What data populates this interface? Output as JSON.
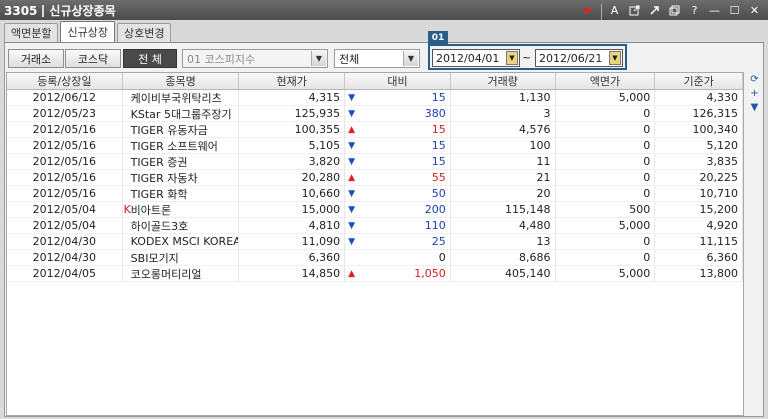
{
  "window": {
    "code": "3305",
    "title": "신규상장종목"
  },
  "titlebar_icons": [
    "play-icon",
    "font-icon",
    "export-icon",
    "link-icon",
    "window-icon",
    "help-icon",
    "minimize-icon",
    "maximize-icon",
    "close-icon"
  ],
  "titlebar_labels": {
    "font": "A",
    "help": "?",
    "min": "—",
    "max": "☐",
    "close": "✕"
  },
  "tabs": [
    {
      "label": "액면분할",
      "active": false
    },
    {
      "label": "신규상장",
      "active": true
    },
    {
      "label": "상호변경",
      "active": false
    }
  ],
  "market_buttons": [
    {
      "label": "거래소",
      "active": false
    },
    {
      "label": "코스닥",
      "active": false
    },
    {
      "label": "전 체",
      "active": true
    }
  ],
  "index_select": {
    "value": "01  코스피지수",
    "disabled": true
  },
  "type_select": {
    "value": "전체"
  },
  "date_range": {
    "tag": "01",
    "start": "2012/04/01",
    "separator": "~",
    "end": "2012/06/21"
  },
  "table": {
    "columns": [
      "등록/상장일",
      "종목명",
      "현재가",
      "대비",
      "거래량",
      "액면가",
      "기준가"
    ],
    "rows": [
      {
        "date": "2012/06/12",
        "name": "케이비부국위탁리츠",
        "price": "4,315",
        "dir": "down",
        "diff": "15",
        "volume": "1,130",
        "face": "5,000",
        "base": "4,330",
        "mark": ""
      },
      {
        "date": "2012/05/23",
        "name": "KStar 5대그룹주장기",
        "price": "125,935",
        "dir": "down",
        "diff": "380",
        "volume": "3",
        "face": "0",
        "base": "126,315",
        "mark": ""
      },
      {
        "date": "2012/05/16",
        "name": "TIGER 유동자금",
        "price": "100,355",
        "dir": "up",
        "diff": "15",
        "volume": "4,576",
        "face": "0",
        "base": "100,340",
        "mark": ""
      },
      {
        "date": "2012/05/16",
        "name": "TIGER 소프트웨어",
        "price": "5,105",
        "dir": "down",
        "diff": "15",
        "volume": "100",
        "face": "0",
        "base": "5,120",
        "mark": ""
      },
      {
        "date": "2012/05/16",
        "name": "TIGER 증권",
        "price": "3,820",
        "dir": "down",
        "diff": "15",
        "volume": "11",
        "face": "0",
        "base": "3,835",
        "mark": ""
      },
      {
        "date": "2012/05/16",
        "name": "TIGER 자동차",
        "price": "20,280",
        "dir": "up",
        "diff": "55",
        "volume": "21",
        "face": "0",
        "base": "20,225",
        "mark": ""
      },
      {
        "date": "2012/05/16",
        "name": "TIGER 화학",
        "price": "10,660",
        "dir": "down",
        "diff": "50",
        "volume": "20",
        "face": "0",
        "base": "10,710",
        "mark": ""
      },
      {
        "date": "2012/05/04",
        "name": "비아트론",
        "price": "15,000",
        "dir": "down",
        "diff": "200",
        "volume": "115,148",
        "face": "500",
        "base": "15,200",
        "mark": "K"
      },
      {
        "date": "2012/05/04",
        "name": "하이골드3호",
        "price": "4,810",
        "dir": "down",
        "diff": "110",
        "volume": "4,480",
        "face": "5,000",
        "base": "4,920",
        "mark": ""
      },
      {
        "date": "2012/04/30",
        "name": "KODEX MSCI KOREA",
        "price": "11,090",
        "dir": "down",
        "diff": "25",
        "volume": "13",
        "face": "0",
        "base": "11,115",
        "mark": ""
      },
      {
        "date": "2012/04/30",
        "name": "SBI모기지",
        "price": "6,360",
        "dir": "none",
        "diff": "0",
        "volume": "8,686",
        "face": "0",
        "base": "6,360",
        "mark": ""
      },
      {
        "date": "2012/04/05",
        "name": "코오롱머티리얼",
        "price": "14,850",
        "dir": "up",
        "diff": "1,050",
        "volume": "405,140",
        "face": "5,000",
        "base": "13,800",
        "mark": ""
      }
    ]
  },
  "side_icons": [
    "refresh-icon",
    "add-icon",
    "scroll-down-icon"
  ],
  "colors": {
    "up": "#d21c1c",
    "down": "#1a3fb8",
    "date_frame": "#2b5d8a",
    "titlebar": "#5a5a5a"
  }
}
